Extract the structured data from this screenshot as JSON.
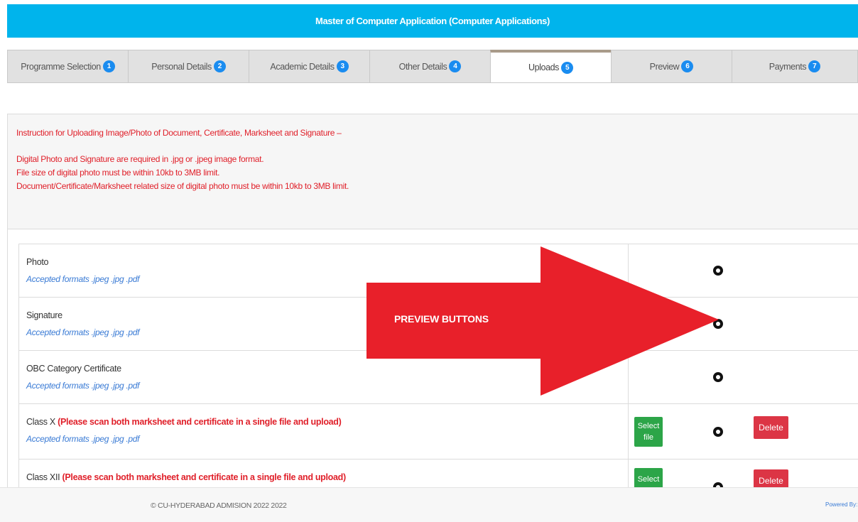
{
  "header": {
    "title": "Master of Computer Application (Computer Applications)"
  },
  "tabs": [
    {
      "label": "Programme Selection",
      "step": "1"
    },
    {
      "label": "Personal Details",
      "step": "2"
    },
    {
      "label": "Academic Details",
      "step": "3"
    },
    {
      "label": "Other Details",
      "step": "4"
    },
    {
      "label": "Uploads",
      "step": "5",
      "active": true
    },
    {
      "label": "Preview",
      "step": "6"
    },
    {
      "label": "Payments",
      "step": "7"
    }
  ],
  "instructions": {
    "heading": "Instruction for Uploading Image/Photo of Document, Certificate, Marksheet and Signature –",
    "lines": [
      "Digital Photo and Signature are required in .jpg or .jpeg image format.",
      "File size of digital photo must be within 10kb to 3MB limit.",
      "Document/Certificate/Marksheet related size of digital photo must be within 10kb to 3MB limit."
    ]
  },
  "documents": [
    {
      "name": "Photo",
      "formats": "Accepted formats .jpeg .jpg .pdf"
    },
    {
      "name": "Signature",
      "formats": "Accepted formats .jpeg .jpg .pdf"
    },
    {
      "name": "OBC Category Certificate",
      "formats": "Accepted formats .jpeg .jpg .pdf"
    },
    {
      "name": "Class X",
      "note": "(Please scan both marksheet and certificate in a single file and upload)",
      "formats": "Accepted formats .jpeg .jpg .pdf"
    },
    {
      "name": "Class XII",
      "note": "(Please scan both marksheet and certificate in a single file and upload)"
    }
  ],
  "buttons": {
    "select_file": "Select file",
    "select_short": "Select",
    "delete": "Delete"
  },
  "annotation": {
    "label": "PREVIEW BUTTONS",
    "color": "#e8202a"
  },
  "footer": {
    "copyright": "© CU-HYDERABAD ADMISION 2022 2022",
    "powered": "Powered By: P"
  },
  "colors": {
    "banner": "#00b4ec",
    "badge": "#1a8cf0",
    "select": "#2ca548",
    "delete": "#dc3545",
    "instruction_text": "#e0202a"
  }
}
